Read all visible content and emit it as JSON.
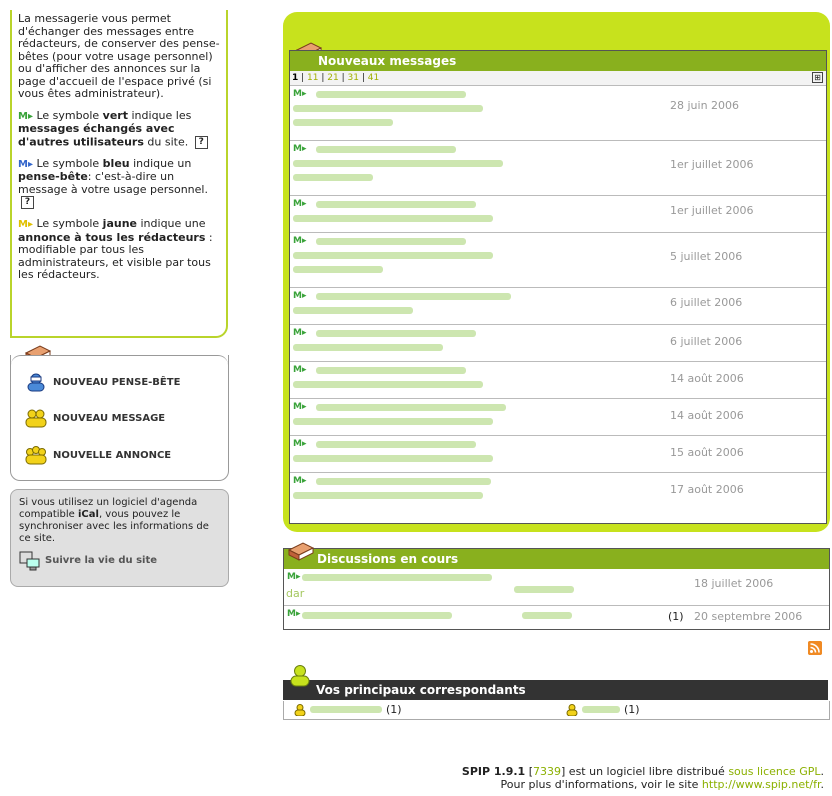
{
  "help": {
    "intro": "La messagerie vous permet d'échanger des messages entre rédacteurs, de conserver des pense-bêtes (pour votre usage personnel) ou d'afficher des annonces sur la page d'accueil de l'espace privé (si vous êtes administrateur).",
    "green_symbol": "M▸",
    "green_a": " Le symbole ",
    "green_word": "vert",
    "green_b": " indique les ",
    "green_bold": "messages échangés avec d'autres utilisateurs",
    "green_c": " du site.",
    "blue_symbol": "M▸",
    "blue_a": " Le symbole ",
    "blue_word": "bleu",
    "blue_b": " indique un ",
    "blue_bold": "pense-bête",
    "blue_c": ": c'est-à-dire un message à votre usage personnel.",
    "yellow_symbol": "M▸",
    "yellow_a": " Le symbole ",
    "yellow_word": "jaune",
    "yellow_b": " indique une ",
    "yellow_bold": "annonce à tous les rédacteurs",
    "yellow_c": " : modifiable par tous les administrateurs, et visible par tous les rédacteurs.",
    "help_mark": "?"
  },
  "actions": {
    "pense_bete": "NOUVEAU PENSE-BÊTE",
    "message": "NOUVEAU MESSAGE",
    "annonce": "NOUVELLE ANNONCE"
  },
  "ical": {
    "text": "Si vous utilisez un logiciel d'agenda compatible ",
    "bold": "iCal",
    "text2": ", vous pouvez le synchroniser avec les informations de ce site.",
    "link": "Suivre la vie du site"
  },
  "messages": {
    "title": "Nouveaux messages",
    "pager": {
      "current": "1",
      "pages": [
        "11",
        "21",
        "31",
        "41"
      ],
      "expand": "⊞"
    },
    "rows": [
      {
        "marker": "M▸",
        "date": "28 juin 2006"
      },
      {
        "marker": "M▸",
        "date": "1er juillet 2006"
      },
      {
        "marker": "M▸",
        "date": "1er juillet 2006"
      },
      {
        "marker": "M▸",
        "date": "5 juillet 2006"
      },
      {
        "marker": "M▸",
        "date": "6 juillet 2006"
      },
      {
        "marker": "M▸",
        "date": "6 juillet 2006"
      },
      {
        "marker": "M▸",
        "date": "14 août 2006"
      },
      {
        "marker": "M▸",
        "date": "14 août 2006"
      },
      {
        "marker": "M▸",
        "date": "15 août 2006"
      },
      {
        "marker": "M▸",
        "date": "17 août 2006"
      }
    ]
  },
  "discussions": {
    "title": "Discussions en cours",
    "rows": [
      {
        "marker": "M▸",
        "fragment": "dar",
        "count": "",
        "date": "18 juillet 2006"
      },
      {
        "marker": "M▸",
        "fragment": "",
        "count": "(1)",
        "date": "20 septembre 2006"
      }
    ]
  },
  "correspondants": {
    "title": "Vos principaux correspondants",
    "people": [
      {
        "count": "(1)"
      },
      {
        "count": "(1)"
      }
    ]
  },
  "footer": {
    "spip": "SPIP 1.9.1",
    "rev_open": " [",
    "rev": "7339",
    "rev_close": "]",
    "text": " est un logiciel libre distribué ",
    "licence": "sous licence GPL",
    "dot": ".",
    "line2": "Pour plus d'informations, voir le site ",
    "url": "http://www.spip.net/fr",
    "dot2": "."
  }
}
